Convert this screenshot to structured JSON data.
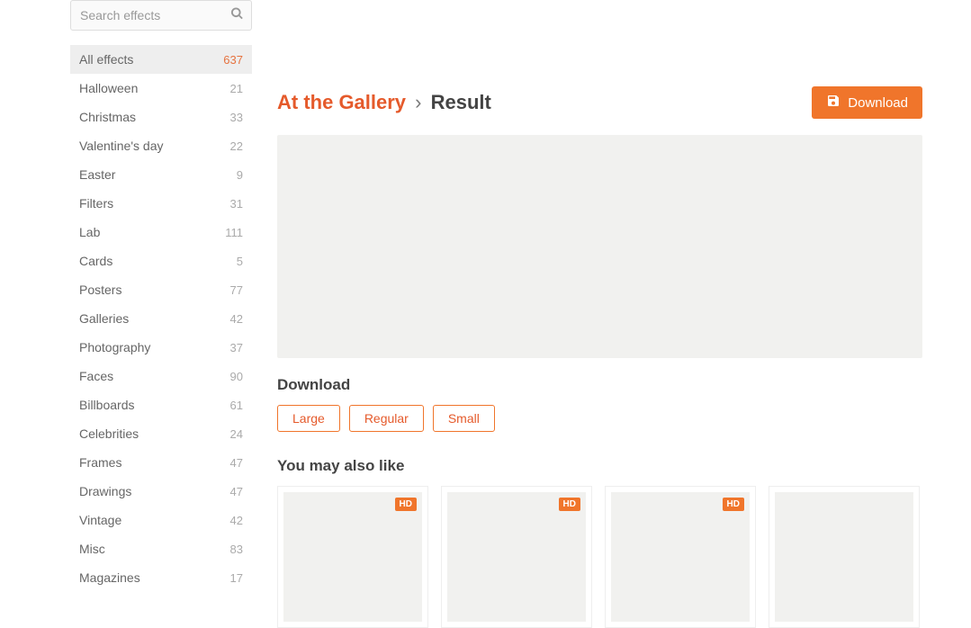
{
  "search": {
    "placeholder": "Search effects"
  },
  "sidebar": {
    "items": [
      {
        "label": "All effects",
        "count": "637",
        "active": true
      },
      {
        "label": "Halloween",
        "count": "21"
      },
      {
        "label": "Christmas",
        "count": "33"
      },
      {
        "label": "Valentine's day",
        "count": "22"
      },
      {
        "label": "Easter",
        "count": "9"
      },
      {
        "label": "Filters",
        "count": "31"
      },
      {
        "label": "Lab",
        "count": "111"
      },
      {
        "label": "Cards",
        "count": "5"
      },
      {
        "label": "Posters",
        "count": "77"
      },
      {
        "label": "Galleries",
        "count": "42"
      },
      {
        "label": "Photography",
        "count": "37"
      },
      {
        "label": "Faces",
        "count": "90"
      },
      {
        "label": "Billboards",
        "count": "61"
      },
      {
        "label": "Celebrities",
        "count": "24"
      },
      {
        "label": "Frames",
        "count": "47"
      },
      {
        "label": "Drawings",
        "count": "47"
      },
      {
        "label": "Vintage",
        "count": "42"
      },
      {
        "label": "Misc",
        "count": "83"
      },
      {
        "label": "Magazines",
        "count": "17"
      }
    ]
  },
  "breadcrumb": {
    "link": "At the Gallery",
    "sep": "›",
    "current": "Result"
  },
  "download_button": "Download",
  "download_section": "Download",
  "sizes": {
    "large": "Large",
    "regular": "Regular",
    "small": "Small"
  },
  "also_like": "You may also like",
  "hd_label": "HD",
  "like_cards": [
    {
      "hd": true
    },
    {
      "hd": true
    },
    {
      "hd": true
    },
    {
      "hd": false
    }
  ]
}
